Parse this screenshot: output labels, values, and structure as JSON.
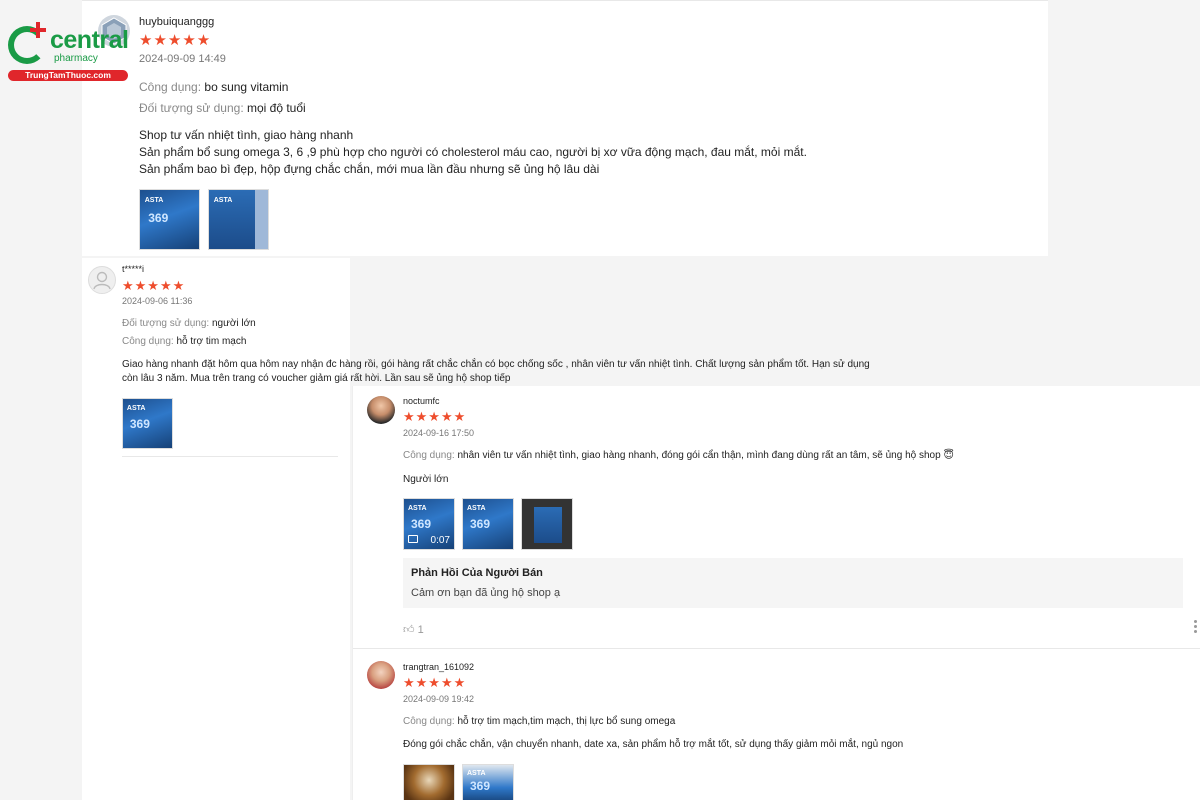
{
  "logo": {
    "brand": "central",
    "sub": "pharmacy",
    "site": "TrungTamThuoc.com"
  },
  "reviews": [
    {
      "username": "huybuiquanggg",
      "stars": "★★★★★",
      "date": "2024-09-09 14:49",
      "fields": [
        {
          "label": "Công dụng:",
          "value": "bo sung vitamin"
        },
        {
          "label": "Đối tượng sử dụng:",
          "value": "mọi độ tuổi"
        }
      ],
      "text_lines": [
        "Shop tư vấn nhiệt tình, giao hàng nhanh",
        "Sản phẩm bổ sung omega 3, 6 ,9 phù hợp cho người có cholesterol máu cao, người bị xơ vữa động mạch, đau mắt, mỏi mắt.",
        "Sản phẩm bao bì đẹp, hộp đựng chắc chắn, mới mua lần đầu nhưng sẽ ủng hộ lâu dài"
      ]
    },
    {
      "username": "t*****i",
      "stars": "★★★★★",
      "date": "2024-09-06 11:36",
      "fields": [
        {
          "label": "Đối tượng sử dụng:",
          "value": "người lớn"
        },
        {
          "label": "Công dụng:",
          "value": "hỗ trợ tim mạch"
        }
      ],
      "text_lines": [
        "Giao hàng nhanh đặt hôm qua hôm nay nhận đc hàng rồi, gói hàng rất chắc chắn có bọc chống sốc , nhân viên tư vấn nhiệt tình. Chất lượng sản phẩm tốt. Hạn sử dụng",
        "còn lâu 3 năm. Mua trên trang có voucher giảm giá rất hời. Lần sau sẽ ủng hộ shop tiếp"
      ]
    },
    {
      "username": "noctumfc",
      "stars": "★★★★★",
      "date": "2024-09-16 17:50",
      "fields": [
        {
          "label": "Công dụng:",
          "value": "nhân viên tư vấn nhiệt tình, giao hàng nhanh, đóng gói cẩn thận, mình đang dùng rất an tâm, sẽ ủng hộ shop 😇"
        }
      ],
      "text_lines": [
        "Người lớn"
      ],
      "video_duration": "0:07",
      "seller_reply": {
        "title": "Phản Hồi Của Người Bán",
        "body": "Cảm ơn bạn đã ủng hộ shop ạ"
      },
      "likes": "1"
    },
    {
      "username": "trangtran_161092",
      "stars": "★★★★★",
      "date": "2024-09-09 19:42",
      "fields": [
        {
          "label": "Công dụng:",
          "value": "hỗ trợ tim mạch,tim mạch, thị lực bổ sung omega"
        }
      ],
      "text_lines": [
        "Đóng gói chắc chắn, vận chuyển nhanh, date xa, sản phẩm hỗ trợ mắt tốt, sử dụng thấy giảm mỏi mắt, ngủ ngon"
      ]
    }
  ],
  "product_box_text": {
    "brand": "ASTA",
    "name": "369"
  },
  "colors": {
    "star": "#ee4d2d",
    "logo_green": "#1a9b46",
    "logo_red": "#e0262b"
  }
}
